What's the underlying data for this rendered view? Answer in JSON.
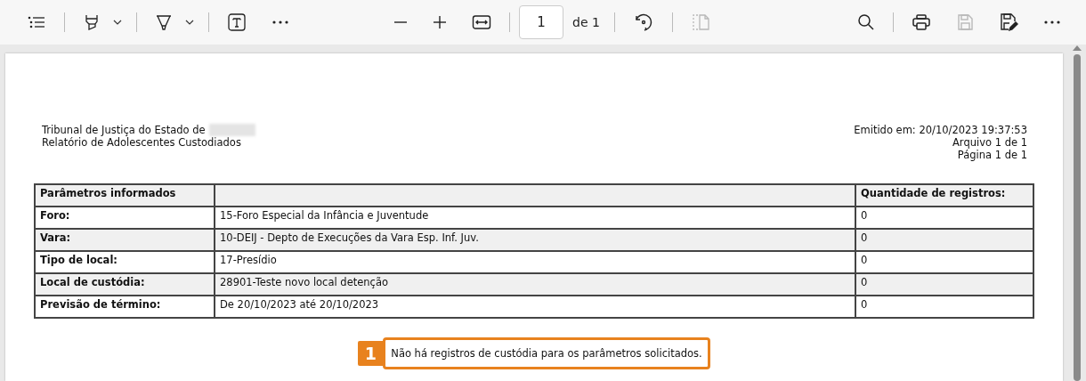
{
  "toolbar": {
    "left": [
      {
        "kind": "contents",
        "disabled": false,
        "dropdown": false
      },
      {
        "kind": "divider"
      },
      {
        "kind": "highlight",
        "disabled": false,
        "dropdown": true
      },
      {
        "kind": "divider"
      },
      {
        "kind": "draw",
        "disabled": false,
        "dropdown": true
      },
      {
        "kind": "divider"
      },
      {
        "kind": "text",
        "disabled": false,
        "dropdown": false
      },
      {
        "kind": "more",
        "disabled": false,
        "dropdown": false
      }
    ],
    "center": [
      {
        "kind": "zoom-out",
        "disabled": false
      },
      {
        "kind": "zoom-in",
        "disabled": false
      },
      {
        "kind": "fit",
        "disabled": false
      },
      {
        "kind": "divider"
      },
      {
        "kind": "page"
      },
      {
        "kind": "divider"
      },
      {
        "kind": "rotate",
        "disabled": false
      },
      {
        "kind": "divider"
      },
      {
        "kind": "view",
        "disabled": true
      }
    ],
    "page_number": {
      "value": "1",
      "total": "de 1"
    },
    "right": [
      {
        "kind": "search",
        "disabled": false
      },
      {
        "kind": "divider"
      },
      {
        "kind": "print",
        "disabled": false
      },
      {
        "kind": "save",
        "disabled": true
      },
      {
        "kind": "save-as",
        "disabled": false
      },
      {
        "kind": "more",
        "disabled": false
      }
    ]
  },
  "document": {
    "header_left": [
      "Tribunal de Justiça do Estado de",
      "Relatório de Adolescentes Custodiados"
    ],
    "header_left_redacted": true,
    "header_right": [
      "Emitido em: 20/10/2023 19:37:53",
      "Arquivo 1 de 1",
      "Página 1 de 1"
    ],
    "table": {
      "columns": [
        "Parâmetros informados",
        "Quantidade de registros:"
      ],
      "rows": [
        {
          "label": "Foro:",
          "value": "15-Foro Especial da Infância e Juventude",
          "count": "0"
        },
        {
          "label": "Vara:",
          "value": "10-DEIJ - Depto de Execuções da Vara Esp. Inf. Juv.",
          "count": "0"
        },
        {
          "label": "Tipo de local:",
          "value": "17-Presídio",
          "count": "0"
        },
        {
          "label": "Local de custódia:",
          "value": "28901-Teste novo local detenção",
          "count": "0"
        },
        {
          "label": "Previsão de término:",
          "value": "De 20/10/2023 até 20/10/2023",
          "count": "0"
        }
      ]
    },
    "callout": {
      "number": "1",
      "message": "Não há registros de custódia para os parâmetros solicitados."
    }
  }
}
